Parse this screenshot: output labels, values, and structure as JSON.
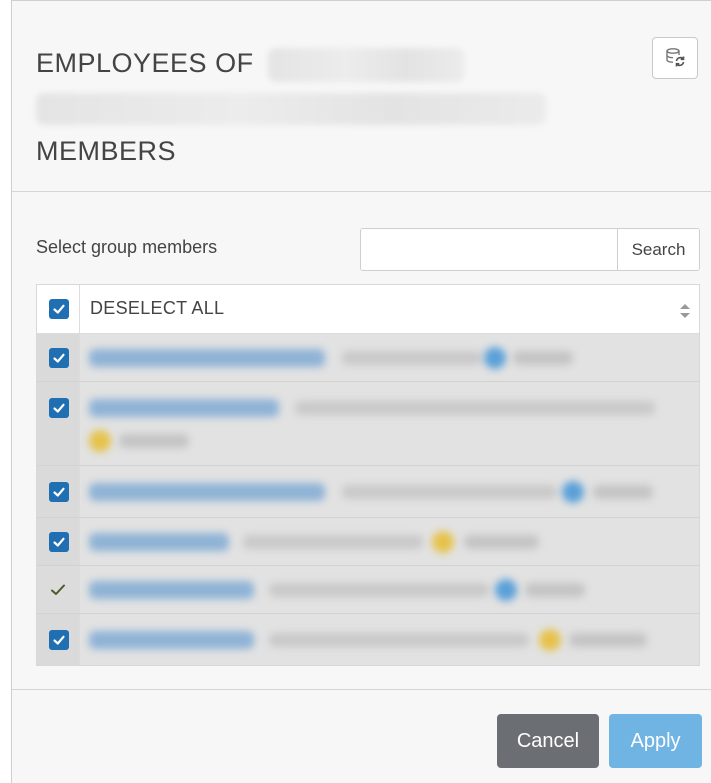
{
  "dialog": {
    "title_prefix": "EMPLOYEES OF",
    "title_suffix": "MEMBERS",
    "refresh_icon": "refresh-database-icon"
  },
  "filter": {
    "label": "Select group members",
    "search_placeholder": "",
    "search_value": "",
    "search_button": "Search"
  },
  "list": {
    "header_label": "DESELECT ALL",
    "header_checked": true,
    "rows": [
      {
        "checked": true,
        "badge_color": "#5aa0d8"
      },
      {
        "checked": true,
        "badge_color": "#e6c24a"
      },
      {
        "checked": true,
        "badge_color": "#5aa0d8"
      },
      {
        "checked": true,
        "badge_color": "#e6c24a"
      },
      {
        "checked": false,
        "checkmark_only": true,
        "badge_color": "#5aa0d8"
      },
      {
        "checked": true,
        "badge_color": "#e6c24a"
      }
    ]
  },
  "footer": {
    "cancel_label": "Cancel",
    "apply_label": "Apply"
  },
  "colors": {
    "checkbox": "#1f6fb2",
    "cancel_button": "#6b6f73",
    "apply_button": "#6fb4e3",
    "link_text": "#2f7bbf"
  }
}
